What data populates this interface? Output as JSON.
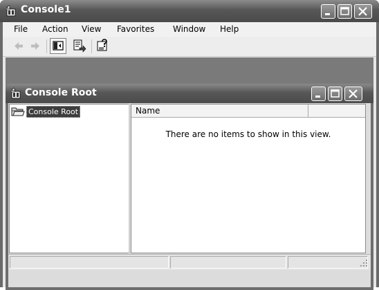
{
  "window": {
    "title": "Console1",
    "icon": "mmc-snapin-icon",
    "controls": [
      "minimize-icon",
      "maximize-icon",
      "close-icon"
    ]
  },
  "menu": {
    "items": [
      {
        "label": "File"
      },
      {
        "label": "Action"
      },
      {
        "label": "View"
      },
      {
        "label": "Favorites"
      },
      {
        "label": "Window"
      },
      {
        "label": "Help"
      }
    ]
  },
  "toolbar": {
    "buttons": [
      "back-arrow-icon",
      "forward-arrow-icon",
      "show-hide-tree-icon",
      "export-list-icon",
      "help-icon"
    ]
  },
  "child_window": {
    "title": "Console Root",
    "icon": "mmc-snapin-icon"
  },
  "tree": {
    "root_label": "Console Root"
  },
  "list": {
    "columns": [
      "Name",
      ""
    ],
    "empty_message": "There are no items to show in this view."
  },
  "status": {
    "segments": [
      "",
      "",
      ""
    ]
  }
}
